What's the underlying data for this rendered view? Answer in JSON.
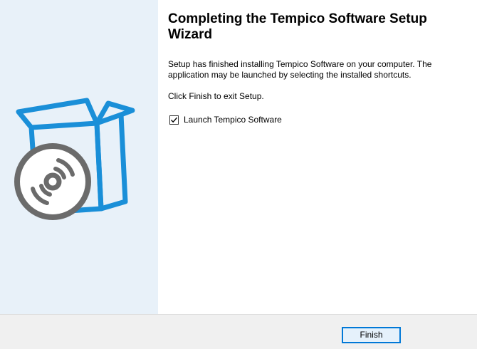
{
  "wizard": {
    "title": "Completing the Tempico Software Setup Wizard",
    "description": "Setup has finished installing Tempico Software on your computer. The application may be launched by selecting the installed shortcuts.",
    "exit_hint": "Click Finish to exit Setup.",
    "launch_option": {
      "label": "Launch Tempico Software",
      "checked": true
    },
    "finish_label": "Finish"
  },
  "icons": {
    "side_art": "software-box-with-disc-icon",
    "checkbox": "checkmark-icon"
  },
  "colors": {
    "side_panel_bg": "#e8f1f9",
    "box_blue": "#1a8fd8",
    "disc_gray": "#6b6b6b",
    "button_border": "#0078d7"
  }
}
